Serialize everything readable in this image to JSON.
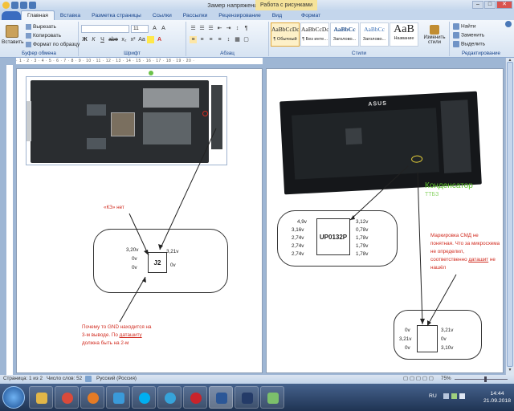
{
  "window": {
    "title": "Замер напряжений - Microsoft Word",
    "context_tab": "Работа с рисунками",
    "buttons": {
      "minimize": "–",
      "maximize": "□",
      "close": "✕"
    }
  },
  "tabs": [
    "Главная",
    "Вставка",
    "Разметка страницы",
    "Ссылки",
    "Рассылки",
    "Рецензирование",
    "Вид",
    "Формат"
  ],
  "ribbon": {
    "clipboard": {
      "paste": "Вставить",
      "cut": "Вырезать",
      "copy": "Копировать",
      "format_painter": "Формат по образцу",
      "label": "Буфер обмена"
    },
    "font": {
      "name": "",
      "size": "11",
      "label": "Шрифт",
      "buttons": [
        "Ж",
        "К",
        "Ч",
        "abe",
        "x₂",
        "x²",
        "Aa",
        "A",
        "A"
      ]
    },
    "paragraph": {
      "label": "Абзац"
    },
    "styles": {
      "label": "Стили",
      "items": [
        {
          "preview": "AaBbCcDc",
          "name": "¶ Обычный"
        },
        {
          "preview": "AaBbCcDc",
          "name": "¶ Без инте..."
        },
        {
          "preview": "AaBbCc",
          "name": "Заголово..."
        },
        {
          "preview": "AaBbCc",
          "name": "Заголово..."
        },
        {
          "preview": "AaB",
          "name": "Название"
        }
      ],
      "change": "Изменить стили"
    },
    "editing": {
      "label": "Редактирование",
      "find": "Найти",
      "replace": "Заменить",
      "select": "Выделить"
    }
  },
  "page1": {
    "kz_label": "«КЗ» нет",
    "chip": {
      "name": "J2",
      "left_pins": [
        "3,20v",
        "0v",
        "0v"
      ],
      "right_pins": [
        "3,21v",
        "0v"
      ]
    },
    "note_lines": [
      "Почему то GND находится на",
      "3-м выводе. По ",
      "даташиту",
      "должна быть на 2-м"
    ]
  },
  "page2": {
    "brand": "ASUS",
    "capacitor_label": "Конденсатор",
    "capacitor_sub": "ТТБЗ",
    "chip": {
      "name": "UP0132P",
      "left_pins": [
        "4,9v",
        "3,16v",
        "2,74v",
        "2,74v",
        "2,74v"
      ],
      "right_pins": [
        "3,12v",
        "0,78v",
        "1,78v",
        "1,79v",
        "1,78v"
      ]
    },
    "note_lines": [
      "Маркировка СМД не",
      "понятная. Что за микросхема",
      "не определил,",
      "соответственно ",
      "даташит",
      " не",
      "нашёл"
    ],
    "small_chip": {
      "left_pins": [
        "0v",
        "3,21v",
        "0v"
      ],
      "right_pins": [
        "3,21v",
        "0v",
        "3,10v"
      ]
    }
  },
  "status": {
    "page": "Страница: 1 из 2",
    "words": "Число слов: 52",
    "language": "Русский (Россия)",
    "zoom": "75%"
  },
  "taskbar": {
    "lang": "RU",
    "time": "14:44",
    "date": "21.09.2018",
    "apps": [
      {
        "name": "explorer",
        "color": "#e2b648"
      },
      {
        "name": "chrome",
        "color": "#d94a3b"
      },
      {
        "name": "firefox",
        "color": "#e47b25"
      },
      {
        "name": "mediaplayer",
        "color": "#3a9ad9"
      },
      {
        "name": "skype",
        "color": "#00aff0"
      },
      {
        "name": "telegram",
        "color": "#36a3da"
      },
      {
        "name": "opera",
        "color": "#c9242b"
      },
      {
        "name": "word",
        "color": "#2b5797"
      },
      {
        "name": "ps",
        "color": "#243b68"
      },
      {
        "name": "paint",
        "color": "#7cc06b"
      }
    ]
  }
}
